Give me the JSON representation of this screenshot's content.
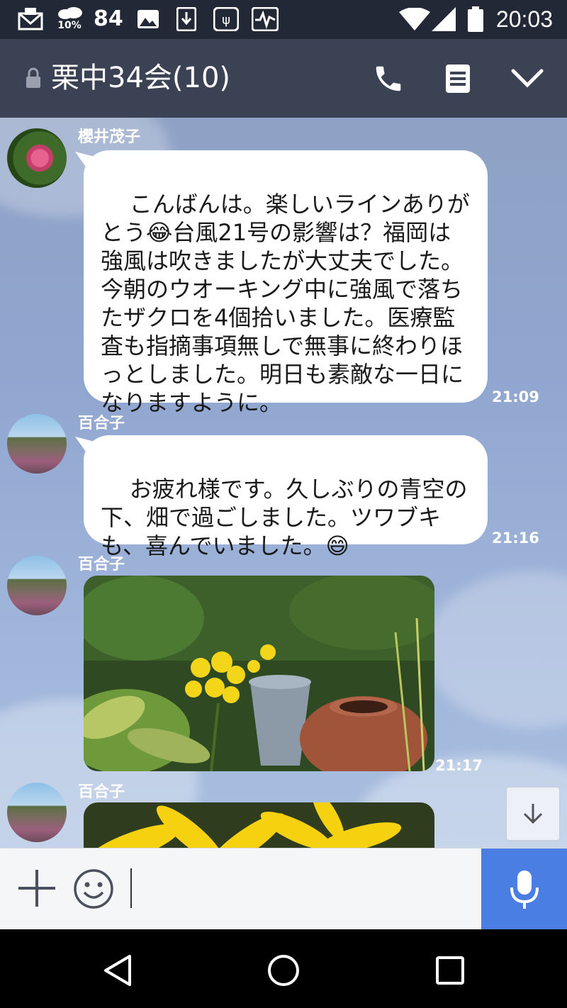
{
  "status_bar": {
    "notification_count": "84",
    "weather_percent": "10%",
    "time": "20:03"
  },
  "header": {
    "title": "栗中34会(10)"
  },
  "messages": [
    {
      "sender": "櫻井茂子",
      "text": "こんばんは。楽しいラインありがとう😂台風21号の影響は？福岡は強風は吹きましたが大丈夫でした。今朝のウオーキング中に強風で落ちたザクロを4個拾いました。医療監査も指摘事項無しで無事に終わりほっとしました。明日も素敵な一日になりますように。",
      "time": "21:09"
    },
    {
      "sender": "百合子",
      "text": "お疲れ様です。久しぶりの青空の下、畑で過ごしました。ツワブキも、喜んでいました。😄",
      "time": "21:16"
    },
    {
      "sender": "百合子",
      "type": "photo",
      "time": "21:17"
    },
    {
      "sender": "百合子",
      "type": "photo"
    }
  ],
  "icons": {
    "lock": "lock-icon",
    "phone": "phone-icon",
    "notes": "notes-icon",
    "menu": "chevron-down-icon",
    "scroll": "arrow-down-icon",
    "plus": "plus-icon",
    "emoji": "smiley-icon",
    "mic": "microphone-icon",
    "back": "back-triangle-icon",
    "home": "home-circle-icon",
    "recents": "recents-square-icon"
  },
  "colors": {
    "header_bg": "#3b4254",
    "status_bg": "#222836",
    "mic_bg": "#4a7ee3",
    "bubble_bg": "#ffffff"
  }
}
